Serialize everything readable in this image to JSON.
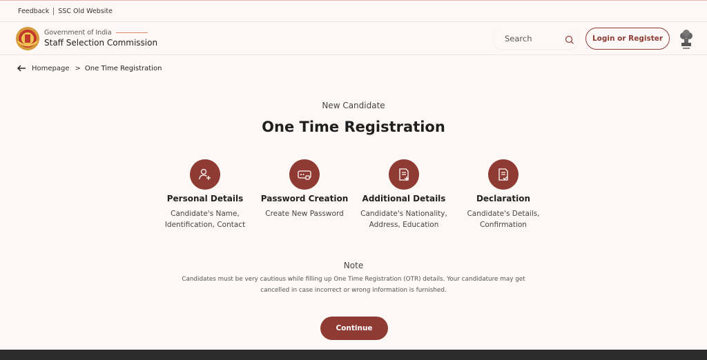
{
  "topbar": {
    "feedback": "Feedback",
    "old_site": "SSC Old Website"
  },
  "header": {
    "gov": "Government of India",
    "org": "Staff Selection Commission",
    "search_placeholder": "Search",
    "login": "Login or Register"
  },
  "breadcrumb": {
    "home": "Homepage",
    "separator": ">",
    "current": "One Time Registration"
  },
  "page": {
    "eyebrow": "New Candidate",
    "title": "One Time Registration"
  },
  "steps": [
    {
      "title": "Personal Details",
      "desc": "Candidate's Name, Identification, Contact",
      "icon": "add-user-icon"
    },
    {
      "title": "Password Creation",
      "desc": "Create New Password",
      "icon": "password-icon"
    },
    {
      "title": "Additional Details",
      "desc": "Candidate's Nationality, Address, Education",
      "icon": "document-add-icon"
    },
    {
      "title": "Declaration",
      "desc": "Candidate's Details, Confirmation",
      "icon": "document-check-icon"
    }
  ],
  "note": {
    "heading": "Note",
    "text": "Candidates must be very cautious while filling up One Time Registration (OTR) details. Your candidature may get cancelled in case incorrect or wrong information is furnished."
  },
  "continue_label": "Continue",
  "colors": {
    "accent": "#8f3b34",
    "background": "#fdf8f6",
    "footer": "#2c2c2c"
  }
}
